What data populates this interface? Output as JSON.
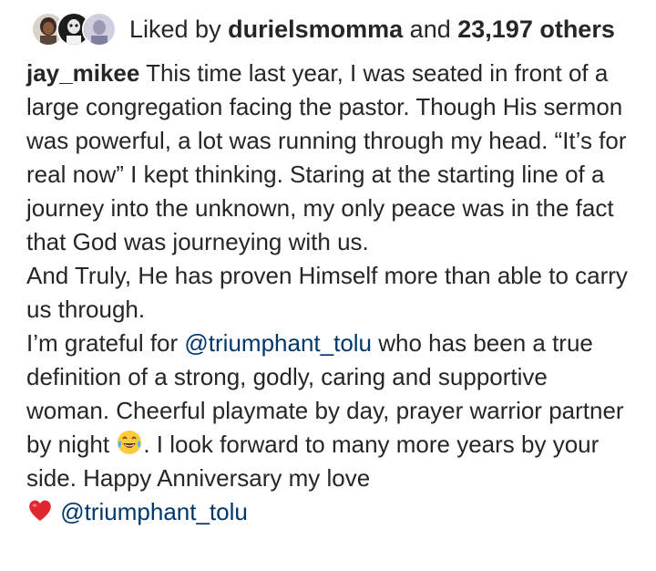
{
  "likes": {
    "prefix": "Liked by",
    "user": "durielsmomma",
    "middle": "and",
    "count": "23,197 others",
    "avatars": [
      {
        "name": "liker-avatar-1"
      },
      {
        "name": "liker-avatar-2"
      },
      {
        "name": "liker-avatar-3"
      }
    ]
  },
  "caption": {
    "username": "jay_mikee",
    "paragraph1": "This time last year, I was seated in front of a large congregation facing the pastor. Though His sermon was powerful, a lot was running through my head. “It’s for real now” I kept thinking. Staring at the starting line of a journey into the unknown, my only peace was in the fact that God was journeying with us.",
    "paragraph2": "And Truly, He has proven Himself more than able to carry us through.",
    "paragraph3_start": "I’m grateful for",
    "mention1": "@triumphant_tolu",
    "paragraph3_mid": "who has been a true definition of a strong, godly, caring and supportive woman. Cheerful playmate by day, prayer warrior partner by night",
    "paragraph3_end": ". I look forward to many more years by your side. Happy Anniversary my love",
    "mention2": "@triumphant_tolu",
    "emoji_laugh": "tears-of-joy-emoji",
    "emoji_heart": "red-heart-emoji"
  },
  "colors": {
    "text": "#262626",
    "mention": "#00376b",
    "heart": "#e0262f",
    "emoji_face": "#ffcb3d"
  }
}
